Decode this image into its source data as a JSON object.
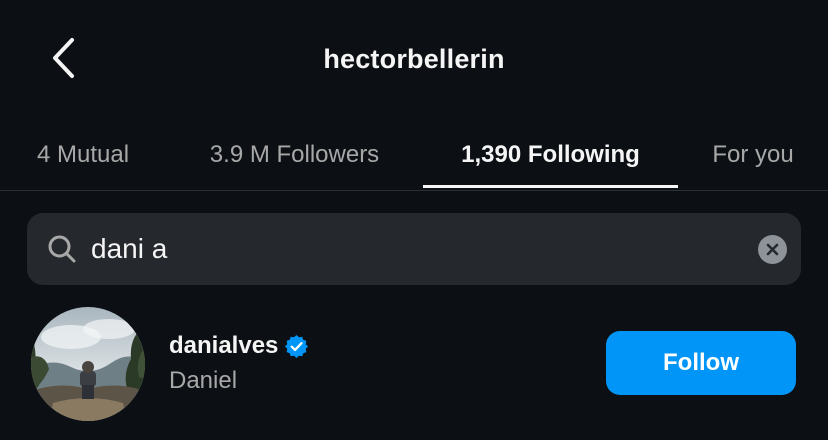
{
  "header": {
    "title": "hectorbellerin",
    "back_icon": "chevron-left-icon"
  },
  "tabs": [
    {
      "label": "4 Mutual",
      "active": false
    },
    {
      "label": "3.9 M Followers",
      "active": false
    },
    {
      "label": "1,390 Following",
      "active": true
    },
    {
      "label": "For you",
      "active": false
    }
  ],
  "search": {
    "value": "dani a",
    "icon": "search-icon",
    "clear_icon": "clear-icon"
  },
  "results": [
    {
      "username": "danialves",
      "full_name": "Daniel",
      "verified": true,
      "button_label": "Follow"
    }
  ],
  "colors": {
    "background": "#0c1014",
    "search_background": "#25292e",
    "primary_text": "#f5f5f5",
    "secondary_text": "#a8a8a8",
    "follow_button": "#0095f6",
    "verified_badge": "#0095f6"
  }
}
